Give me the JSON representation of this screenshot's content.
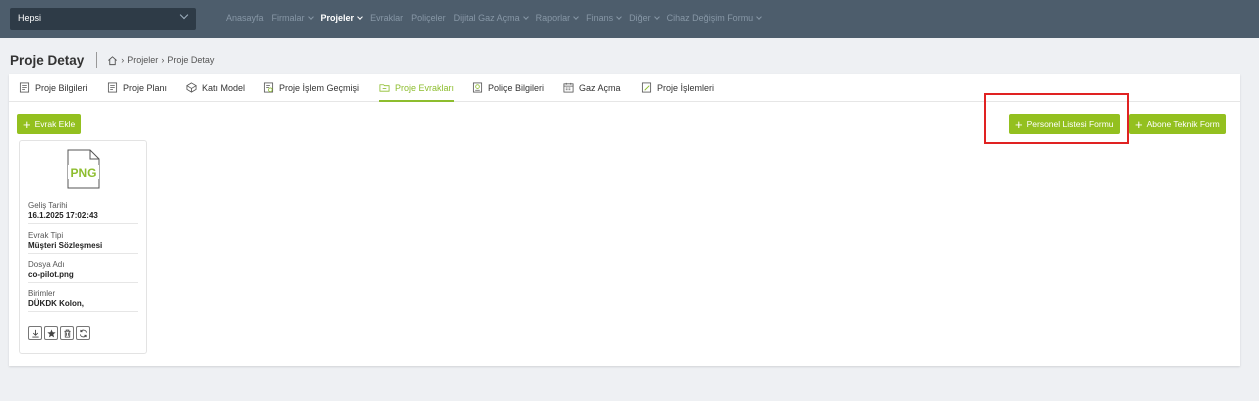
{
  "topbar": {
    "scope_value": "Hepsi",
    "nav": [
      {
        "label": "Anasayfa",
        "dropdown": false,
        "active": false
      },
      {
        "label": "Firmalar",
        "dropdown": true,
        "active": false
      },
      {
        "label": "Projeler",
        "dropdown": true,
        "active": true
      },
      {
        "label": "Evraklar",
        "dropdown": false,
        "active": false
      },
      {
        "label": "Poliçeler",
        "dropdown": false,
        "active": false
      },
      {
        "label": "Dijital Gaz Açma",
        "dropdown": true,
        "active": false
      },
      {
        "label": "Raporlar",
        "dropdown": true,
        "active": false
      },
      {
        "label": "Finans",
        "dropdown": true,
        "active": false
      },
      {
        "label": "Diğer",
        "dropdown": true,
        "active": false
      },
      {
        "label": "Cihaz Değişim Formu",
        "dropdown": true,
        "active": false
      }
    ]
  },
  "page": {
    "title": "Proje Detay",
    "breadcrumb": [
      "Projeler",
      "Proje Detay"
    ]
  },
  "tabs": [
    {
      "label": "Proje Bilgileri",
      "icon": "document-icon",
      "active": false
    },
    {
      "label": "Proje Planı",
      "icon": "document-icon",
      "active": false
    },
    {
      "label": "Katı Model",
      "icon": "cube-icon",
      "active": false
    },
    {
      "label": "Proje İşlem Geçmişi",
      "icon": "document-history-icon",
      "active": false
    },
    {
      "label": "Proje Evrakları",
      "icon": "folder-icon",
      "active": true
    },
    {
      "label": "Poliçe Bilgileri",
      "icon": "policy-icon",
      "active": false
    },
    {
      "label": "Gaz Açma",
      "icon": "calendar-icon",
      "active": false
    },
    {
      "label": "Proje İşlemleri",
      "icon": "edit-document-icon",
      "active": false
    }
  ],
  "buttons": {
    "add_document": "Evrak Ekle",
    "personnel_list_form": "Personel Listesi Formu",
    "subscriber_technical_form": "Abone Teknik Form"
  },
  "document": {
    "file_type": "PNG",
    "fields": [
      {
        "label": "Geliş Tarihi",
        "value": "16.1.2025 17:02:43"
      },
      {
        "label": "Evrak Tipi",
        "value": "Müşteri Sözleşmesi"
      },
      {
        "label": "Dosya Adı",
        "value": "co-pilot.png"
      },
      {
        "label": "Birimler",
        "value": "DÜKDK Kolon,"
      }
    ],
    "actions": [
      "download-icon",
      "star-icon",
      "trash-icon",
      "refresh-icon"
    ]
  },
  "colors": {
    "topbar": "#4d5d6c",
    "accent_green": "#93c01f",
    "highlight_red": "#e02222"
  }
}
